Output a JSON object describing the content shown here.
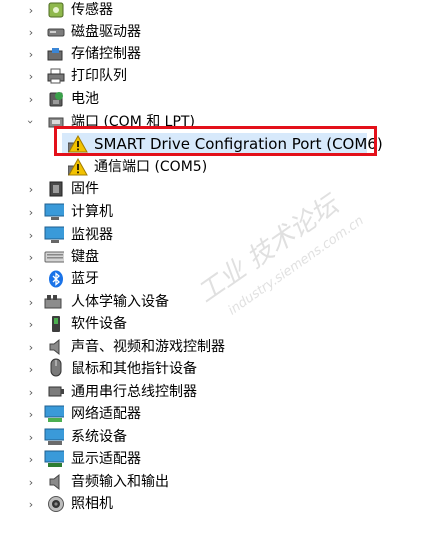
{
  "device_tree": {
    "items": [
      {
        "label": "传感器",
        "icon": "sensor-icon",
        "expanded": false
      },
      {
        "label": "磁盘驱动器",
        "icon": "disk-drive-icon",
        "expanded": false
      },
      {
        "label": "存储控制器",
        "icon": "storage-controller-icon",
        "expanded": false
      },
      {
        "label": "打印队列",
        "icon": "printer-icon",
        "expanded": false
      },
      {
        "label": "电池",
        "icon": "battery-icon",
        "expanded": false
      },
      {
        "label": "端口 (COM 和 LPT)",
        "icon": "port-icon",
        "expanded": true
      },
      {
        "label": "SMART Drive Configration Port (COM6)",
        "icon": "warning-icon",
        "child": true,
        "selected": true
      },
      {
        "label": "通信端口 (COM5)",
        "icon": "warning-icon",
        "child": true
      },
      {
        "label": "固件",
        "icon": "firmware-icon",
        "expanded": false
      },
      {
        "label": "计算机",
        "icon": "computer-icon",
        "expanded": false
      },
      {
        "label": "监视器",
        "icon": "monitor-icon",
        "expanded": false
      },
      {
        "label": "键盘",
        "icon": "keyboard-icon",
        "expanded": false
      },
      {
        "label": "蓝牙",
        "icon": "bluetooth-icon",
        "expanded": false
      },
      {
        "label": "人体学输入设备",
        "icon": "hid-icon",
        "expanded": false
      },
      {
        "label": "软件设备",
        "icon": "software-device-icon",
        "expanded": false
      },
      {
        "label": "声音、视频和游戏控制器",
        "icon": "speaker-icon",
        "expanded": false
      },
      {
        "label": "鼠标和其他指针设备",
        "icon": "mouse-icon",
        "expanded": false
      },
      {
        "label": "通用串行总线控制器",
        "icon": "usb-icon",
        "expanded": false
      },
      {
        "label": "网络适配器",
        "icon": "network-adapter-icon",
        "expanded": false
      },
      {
        "label": "系统设备",
        "icon": "system-device-icon",
        "expanded": false
      },
      {
        "label": "显示适配器",
        "icon": "display-adapter-icon",
        "expanded": false
      },
      {
        "label": "音频输入和输出",
        "icon": "audio-io-icon",
        "expanded": false
      },
      {
        "label": "照相机",
        "icon": "camera-icon",
        "expanded": false
      }
    ]
  },
  "watermark": {
    "text_cn": "工业 技术论坛",
    "text_url": "industry.siemens.com.cn"
  },
  "colors": {
    "highlight_border": "#e3101a",
    "selection_bg": "#d7e9fb",
    "warning_yellow": "#f2c200"
  }
}
